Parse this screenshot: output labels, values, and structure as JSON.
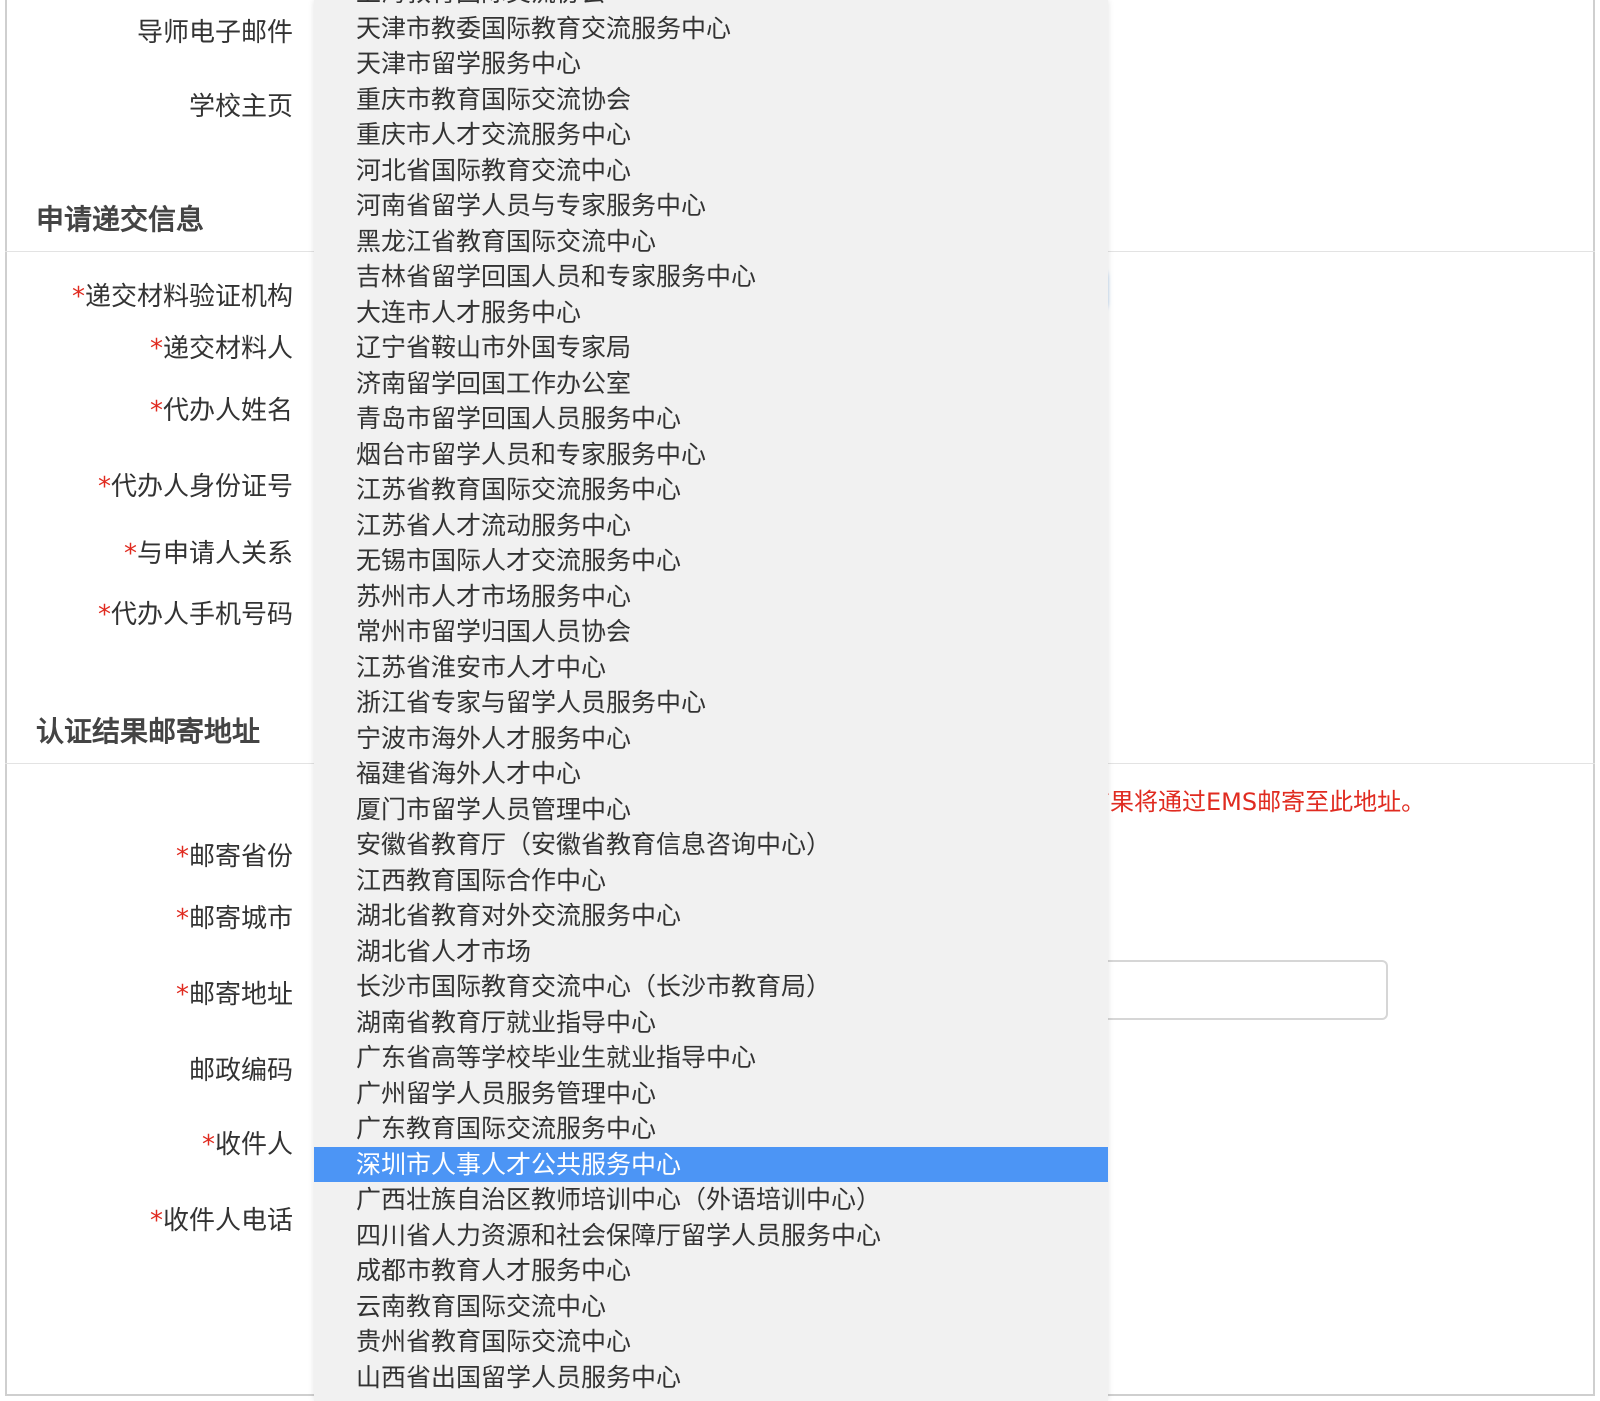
{
  "labels": {
    "mentor_email": "导师电子邮件",
    "school_homepage": "学校主页",
    "verify_org": "递交材料验证机构",
    "submitter": "递交材料人",
    "agent_name": "代办人姓名",
    "agent_id": "代办人身份证号",
    "relation": "与申请人关系",
    "agent_phone": "代办人手机号码",
    "mail_province": "邮寄省份",
    "mail_city": "邮寄城市",
    "mail_address": "邮寄地址",
    "postcode": "邮政编码",
    "recipient": "收件人",
    "recipient_phone": "收件人电话"
  },
  "required_mark": "*",
  "sections": {
    "submit_info": "申请递交信息",
    "mail_address": "认证结果邮寄地址"
  },
  "notice_partial": "吉果将通过EMS邮寄至此地址。",
  "select_arrows": "▲\n▼",
  "colors": {
    "selected_bg": "#4c95f5",
    "required": "#e02b20",
    "focus": "#5b9bd5"
  },
  "dropdown": {
    "selected_index": 33,
    "options": [
      "上海教育国际交流协会",
      "天津市教委国际教育交流服务中心",
      "天津市留学服务中心",
      "重庆市教育国际交流协会",
      "重庆市人才交流服务中心",
      "河北省国际教育交流中心",
      "河南省留学人员与专家服务中心",
      "黑龙江省教育国际交流中心",
      "吉林省留学回国人员和专家服务中心",
      "大连市人才服务中心",
      "辽宁省鞍山市外国专家局",
      "济南留学回国工作办公室",
      "青岛市留学回国人员服务中心",
      "烟台市留学人员和专家服务中心",
      "江苏省教育国际交流服务中心",
      "江苏省人才流动服务中心",
      "无锡市国际人才交流服务中心",
      "苏州市人才市场服务中心",
      "常州市留学归国人员协会",
      "江苏省淮安市人才中心",
      "浙江省专家与留学人员服务中心",
      "宁波市海外人才服务中心",
      "福建省海外人才中心",
      "厦门市留学人员管理中心",
      "安徽省教育厅（安徽省教育信息咨询中心）",
      "江西教育国际合作中心",
      "湖北省教育对外交流服务中心",
      "湖北省人才市场",
      "长沙市国际教育交流中心（长沙市教育局）",
      "湖南省教育厅就业指导中心",
      "广东省高等学校毕业生就业指导中心",
      "广州留学人员服务管理中心",
      "广东教育国际交流服务中心",
      "深圳市人事人才公共服务中心",
      "广西壮族自治区教师培训中心（外语培训中心）",
      "四川省人力资源和社会保障厅留学人员服务中心",
      "成都市教育人才服务中心",
      "云南教育国际交流中心",
      "贵州省教育国际交流中心",
      "山西省出国留学人员服务中心"
    ]
  }
}
